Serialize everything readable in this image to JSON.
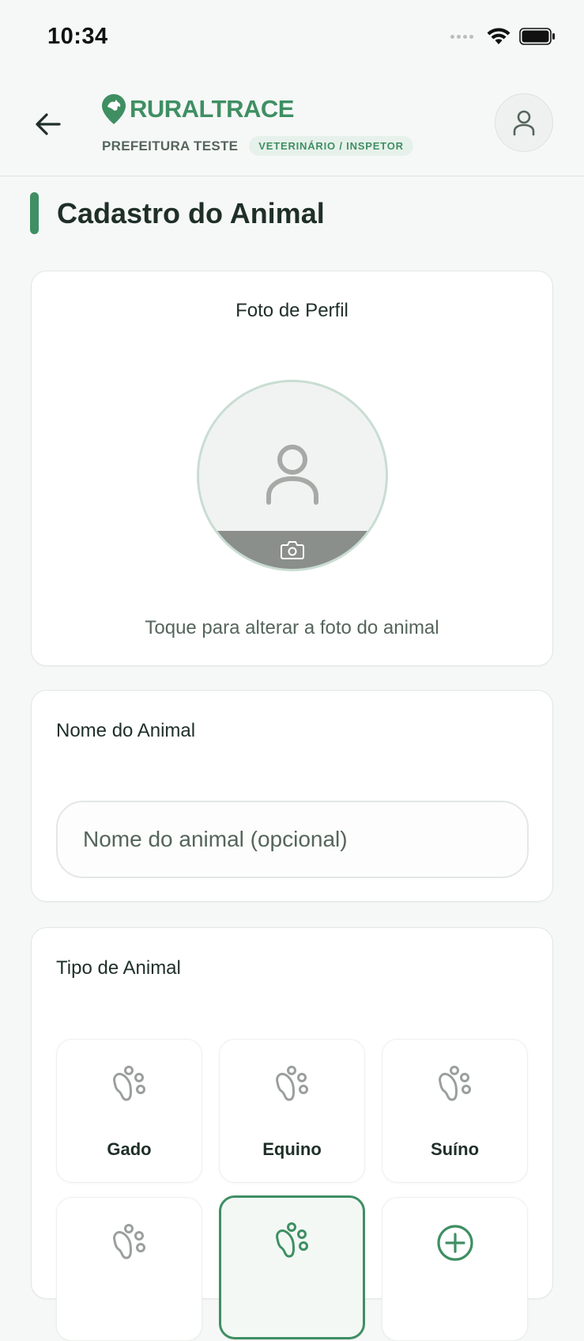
{
  "status_bar": {
    "time": "10:34"
  },
  "header": {
    "brand_name": "RURALTRACE",
    "municipality": "PREFEITURA TESTE",
    "role_badge": "VETERINÁRIO / INSPETOR"
  },
  "page": {
    "title": "Cadastro do Animal"
  },
  "photo_card": {
    "label": "Foto de Perfil",
    "hint": "Toque para alterar a foto do animal"
  },
  "name_card": {
    "label": "Nome do Animal",
    "placeholder": "Nome do animal (opcional)"
  },
  "type_card": {
    "label": "Tipo de Animal",
    "options": [
      {
        "label": "Gado",
        "icon": "paw-icon",
        "selected": false
      },
      {
        "label": "Equino",
        "icon": "paw-icon",
        "selected": false
      },
      {
        "label": "Suíno",
        "icon": "paw-icon",
        "selected": false
      },
      {
        "label": "",
        "icon": "paw-icon",
        "selected": false
      },
      {
        "label": "",
        "icon": "paw-icon",
        "selected": true
      },
      {
        "label": "",
        "icon": "plus-circle-icon",
        "selected": false
      }
    ]
  },
  "colors": {
    "brand_green": "#3f8f63",
    "badge_bg": "#e7f1eb",
    "background": "#f6f8f7"
  }
}
